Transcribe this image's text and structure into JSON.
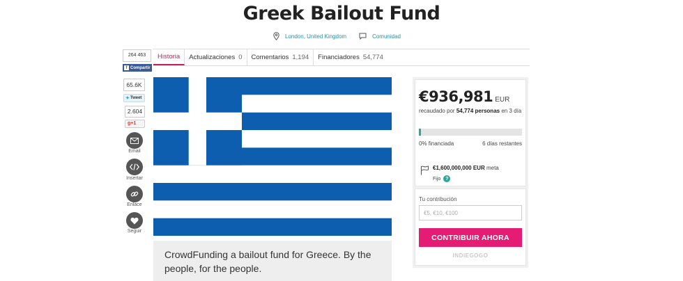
{
  "campaign": {
    "title": "Greek Bailout Fund",
    "location": "London, United Kingdom",
    "category": "Comunidad"
  },
  "tabs": [
    {
      "label": "Historia",
      "count": ""
    },
    {
      "label": "Actualizaciones",
      "count": "0"
    },
    {
      "label": "Comentarios",
      "count": "1,194"
    },
    {
      "label": "Financiadores",
      "count": "54,774"
    }
  ],
  "share": {
    "facebook_count": "264 463",
    "facebook_label": "Compartir",
    "twitter_count": "65.6K",
    "twitter_label": "Tweet",
    "gplus_count": "2.604",
    "gplus_label": "g+1",
    "actions": [
      {
        "label": "Email",
        "icon": "envelope-icon"
      },
      {
        "label": "Insertar",
        "icon": "code-icon"
      },
      {
        "label": "Enlace",
        "icon": "link-icon"
      },
      {
        "label": "Seguir",
        "icon": "heart-icon"
      }
    ]
  },
  "description": "CrowdFunding a bailout fund for Greece. By the people, for the people.",
  "funding": {
    "amount": "€936,981",
    "currency": "EUR",
    "raised_prefix": "recaudado por",
    "backers_text": "54,774 personas",
    "raised_suffix": "en 3 día",
    "progress_fraction": 0.02,
    "percent_text": "0% financiada",
    "days_left": "6 días restantes",
    "goal_amount": "€1,600,000,000 EUR",
    "goal_suffix": "meta",
    "goal_type": "Fijo",
    "help_glyph": "?"
  },
  "contribution": {
    "label": "Tu contribución",
    "placeholder": "€5, €10, €100",
    "button": "CONTRIBUIR AHORA"
  },
  "brand": "INDIEGOGO",
  "colors": {
    "accent": "#e51c74",
    "tab_active": "#c71d5e",
    "progress": "#2aa89a",
    "facebook": "#3b5998",
    "flag_blue": "#0d5eaf"
  }
}
